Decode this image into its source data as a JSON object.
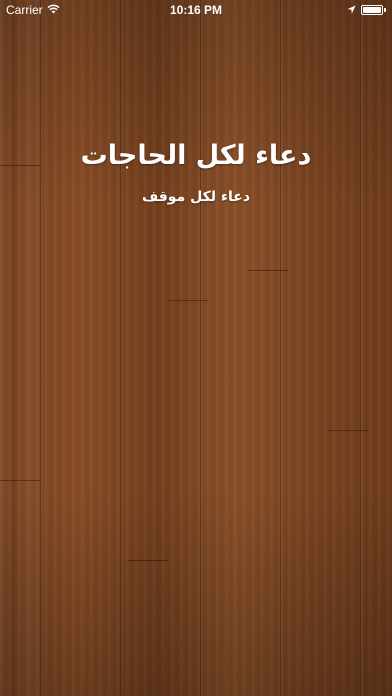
{
  "status_bar": {
    "carrier": "Carrier",
    "wifi_icon": "wifi-icon",
    "time": "10:16 PM",
    "location_icon": "location-arrow-icon",
    "battery_icon": "battery-icon",
    "battery_level": 1.0
  },
  "main": {
    "title": "دعاء لكل الحاجات",
    "subtitle": "دعاء لكل موقف"
  }
}
